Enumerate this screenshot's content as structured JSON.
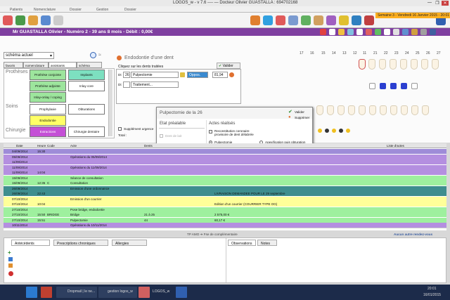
{
  "window": {
    "title": "LOGOS_w - v 7.6 ---- — Docteur Olivier GUASTALLA : 694702168",
    "controls": [
      "—",
      "❐",
      "✕"
    ]
  },
  "menu": {
    "items": [
      "Patients",
      "Nomenclature",
      "Dossier",
      "Gestion",
      "Dossier"
    ]
  },
  "toolbar": {
    "date": "Semaine 3 - Vendredi 16 Janvier 2015 - 20:01"
  },
  "patient": {
    "header": "Mr GUASTALLA Olivier  -  Numéro 2  -  39 ans 8 mois  -  Débit : 0,00€"
  },
  "left": {
    "schema_value": "schéma actuel",
    "tabs": [
      "favoris",
      "nomenclature",
      "assistants",
      "schéma"
    ],
    "sections": [
      "Prothèses",
      "Soins",
      "Chirurgie"
    ],
    "buttons": [
      {
        "label": "Prothèse conjointe",
        "color": "#9de59d"
      },
      {
        "label": "Implants",
        "color": "#7de0c0"
      },
      {
        "label": "Prothèse adjointe",
        "color": "#9de59d"
      },
      {
        "label": "Inlay core",
        "color": "#ffffff"
      },
      {
        "label": "Inlay-onlay / coping",
        "color": "#9de59d"
      },
      {
        "label": "Prophylaxie",
        "color": "#ffffff"
      },
      {
        "label": "Obturations",
        "color": "#ffffff"
      },
      {
        "label": "Endodontie",
        "color": "#ffff66"
      },
      {
        "label": "Extractions",
        "color": "#c44fd6"
      },
      {
        "label": "Chirurgie dentaire",
        "color": "#ffffff"
      }
    ]
  },
  "endo": {
    "title": "Endodontie d'une dent",
    "hint": "Cliquez sur les dents traitées",
    "validate": "Valider",
    "row1": {
      "prefix": "Dt",
      "tooth": "26",
      "act": "Pulpectomie",
      "opposable": "Oppos.",
      "amount": "81,94"
    },
    "row2": {
      "prefix": "Dt",
      "act": "Traitement..."
    },
    "supp_label": "Supplément urgence",
    "total_label": "Total :"
  },
  "dialog": {
    "title": "Pulpectomie de la 26",
    "validate": "Valider",
    "delete": "Supprimer",
    "etat_title": "Etat préalable",
    "etat_items": [
      {
        "label": "Dent de lait",
        "checked": false,
        "disabled": true
      },
      {
        "label": "Canaux pulpés",
        "checked": true,
        "disabled": false
      },
      {
        "label": "Canaux nécrosés",
        "checked": false,
        "disabled": false
      },
      {
        "label": "Canaux obturés",
        "checked": false,
        "disabled": false
      }
    ],
    "mature_label": "Dent mature/apexifiée",
    "actes_title": "Actes réalisés",
    "actes_left": [
      {
        "label": "Reconstitution coronaire provisoire de dent délabrée",
        "type": "check",
        "checked": false
      },
      {
        "label": "Pulpectomie",
        "type": "radio",
        "checked": true
      },
      {
        "label": "Biopulpotomie",
        "type": "radio",
        "checked": false
      },
      {
        "label": "Parage de plaie et coiffage",
        "type": "radio",
        "checked": false
      },
      {
        "label": "Exérèse partielle de la pulpe pour apexogénèse",
        "type": "radio",
        "checked": false
      }
    ],
    "actes_right": [
      {
        "label": "Apexification puis obturation",
        "checked": false,
        "disabled": false
      },
      {
        "label": "Désobturation",
        "checked": false,
        "disabled": true
      },
      {
        "label": "Renouvellement d'obturation à l'hydroxyde de calcium",
        "checked": false,
        "disabled": false
      }
    ],
    "radios_label": "Radios",
    "radios_value": "0"
  },
  "teeth": {
    "upper": [
      "17",
      "16",
      "15",
      "14",
      "13",
      "12",
      "11",
      "21",
      "22",
      "23",
      "24",
      "25",
      "26",
      "27"
    ]
  },
  "table": {
    "headers": [
      "Date",
      "Heure",
      "Code",
      "Acte",
      "Dents",
      "Liste d'actes"
    ],
    "rows": [
      {
        "date": "04/09/2014",
        "heure": "15:30",
        "code": "",
        "acte": "",
        "dents": "",
        "extra": "",
        "color": "#9e8cd8"
      },
      {
        "date": "05/09/2014",
        "heure": "",
        "code": "",
        "acte": "Opérations du 05/09/2014",
        "dents": "",
        "extra": "",
        "color": "#b48fe0"
      },
      {
        "date": "11/09/2014",
        "heure": "",
        "code": "",
        "acte": "",
        "dents": "",
        "extra": "",
        "color": "#b48fe0"
      },
      {
        "date": "11/09/2014",
        "heure": "",
        "code": "",
        "acte": "Opérations du 11/09/2014",
        "dents": "",
        "extra": "",
        "color": "#b48fe0"
      },
      {
        "date": "11/09/2014",
        "heure": "14:04",
        "code": "",
        "acte": "",
        "dents": "",
        "extra": "",
        "color": "#b48fe0"
      },
      {
        "date": "15/09/2014",
        "heure": "",
        "code": "",
        "acte": "Séance de consultation",
        "dents": "",
        "extra": "",
        "color": "#9ef09e"
      },
      {
        "date": "15/09/2014",
        "heure": "12:35",
        "code": "C",
        "acte": "Consultation",
        "dents": "",
        "extra": "",
        "color": "#9ef09e"
      },
      {
        "date": "26/09/2014",
        "heure": "",
        "code": "",
        "acte": "Emission d'une ordonnance",
        "dents": "",
        "extra": "",
        "color": "#3e8e8e"
      },
      {
        "date": "26/09/2014",
        "heure": "22:43",
        "code": "",
        "acte": "",
        "dents": "",
        "extra": "LIVRAISON DEMANDEE POUR LE 29 septembre",
        "color": "#3e8e8e"
      },
      {
        "date": "07/10/2014",
        "heure": "",
        "code": "",
        "acte": "Emission d'un courrier",
        "dents": "",
        "extra": "",
        "color": "#ffff99"
      },
      {
        "date": "07/10/2014",
        "heure": "10:04",
        "code": "",
        "acte": "",
        "dents": "",
        "extra": "Edition d'un courrier (COURRIER TYPE OG)",
        "color": "#ffff99"
      },
      {
        "date": "27/10/2014",
        "heure": "",
        "code": "",
        "acte": "Pose bridge, endodontie",
        "dents": "",
        "extra": "",
        "color": "#9ef09e"
      },
      {
        "date": "27/10/2014",
        "heure": "15:50",
        "code": "BRIDGE",
        "acte": "Bridge",
        "dents": "21 à 25",
        "extra": "2 575,00 €",
        "color": "#9ef09e"
      },
      {
        "date": "27/10/2014",
        "heure": "15:51",
        "code": "",
        "acte": "Pulpectomie",
        "dents": "44",
        "extra": "60,17 €",
        "color": "#9ef09e"
      },
      {
        "date": "10/11/2014",
        "heure": "",
        "code": "",
        "acte": "Opérations du 10/11/2014",
        "dents": "",
        "extra": "",
        "color": "#b48fe0"
      }
    ],
    "footer_left": "TP AMO  ➔  Fse de complémentaire",
    "footer_right": "Aucun autre rendez-vous"
  },
  "bottom": {
    "tabs_left": [
      "Antécédents",
      "Prescriptions chroniques",
      "Allergies"
    ],
    "tabs_right": [
      "Observations",
      "Notes"
    ]
  },
  "taskbar": {
    "items": [
      "Dropmail | le ne...",
      "gestion logos_w",
      "LOGOS_w"
    ],
    "time": "20:01",
    "date": "16/01/2015"
  }
}
